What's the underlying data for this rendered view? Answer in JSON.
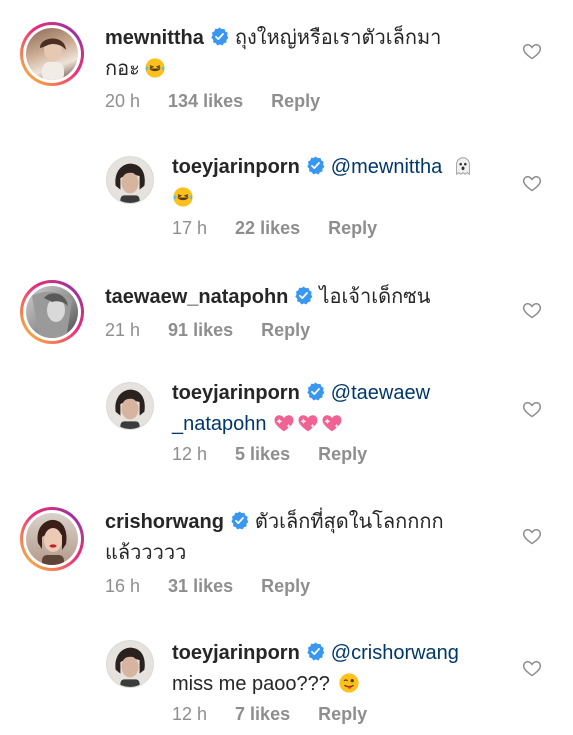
{
  "comments": [
    {
      "username": "mewnittha",
      "text_line1": "ถุงใหญ่หรือเราตัวเล็กมา",
      "text_line2": "กอะ",
      "emoji": "laughing-crying-emoji",
      "time": "20 h",
      "likes": "134 likes",
      "reply": "Reply",
      "avatar_icon": "woman-portrait-avatar"
    },
    {
      "username": "toeyjarinporn",
      "mention": "@mewnittha",
      "emoji1": "ghost-emoji",
      "emoji2": "laughing-crying-emoji",
      "time": "17 h",
      "likes": "22 likes",
      "reply": "Reply",
      "avatar_icon": "woman-bob-avatar"
    },
    {
      "username": "taewaew_natapohn",
      "text_line1": "ไอเจ้าเด็กซน",
      "time": "21 h",
      "likes": "91 likes",
      "reply": "Reply",
      "avatar_icon": "monochrome-portrait-avatar"
    },
    {
      "username": "toeyjarinporn",
      "mention_line1": "@taewaew",
      "mention_line2": "_natapohn",
      "emoji": "pink-heart-emoji",
      "time": "12 h",
      "likes": "5 likes",
      "reply": "Reply",
      "avatar_icon": "woman-bob-avatar"
    },
    {
      "username": "crishorwang",
      "text_line1": "ตัวเล็กที่สุดในโลกกกก",
      "text_line2": "แล้ววววว",
      "time": "16 h",
      "likes": "31 likes",
      "reply": "Reply",
      "avatar_icon": "woman-red-lips-avatar"
    },
    {
      "username": "toeyjarinporn",
      "mention": "@crishorwang",
      "text_line2": "miss me paoo???",
      "emoji": "winking-tongue-emoji",
      "time": "12 h",
      "likes": "7 likes",
      "reply": "Reply",
      "avatar_icon": "woman-bob-avatar"
    }
  ],
  "colors": {
    "verified": "#3897f0",
    "mention": "#00376b",
    "meta": "#8e8e8e",
    "text": "#262626"
  }
}
